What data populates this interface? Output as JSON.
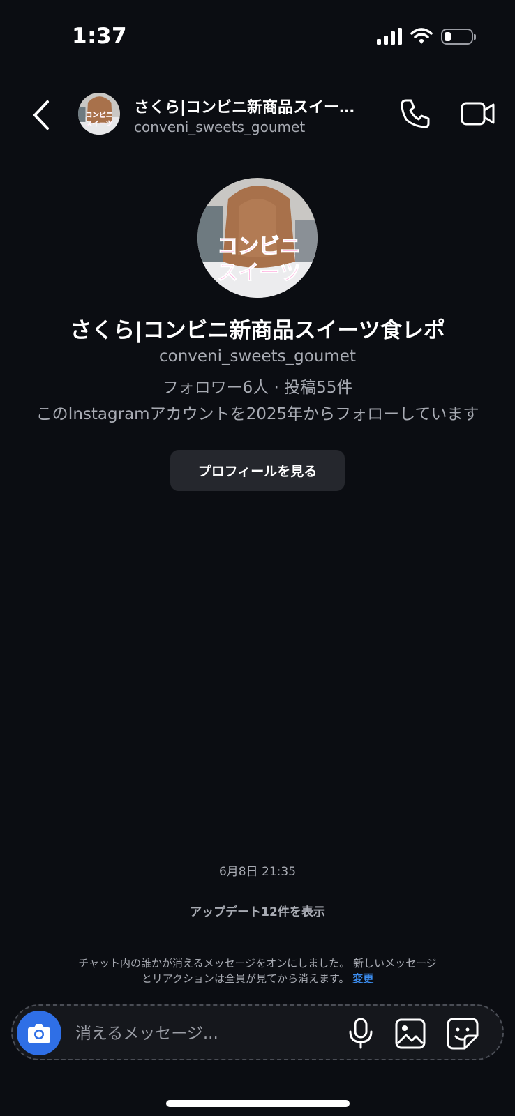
{
  "status_bar": {
    "time": "1:37",
    "battery_level": 0.25
  },
  "header": {
    "title": "さくら|コンビニ新商品スイー…",
    "subtitle": "conveni_sweets_goumet"
  },
  "avatar": {
    "overlay_line1": "コンビニ",
    "overlay_line2": "スイーツ"
  },
  "profile": {
    "name": "さくら|コンビニ新商品スイーツ食レポ",
    "handle": "conveni_sweets_goumet",
    "stats": "フォロワー6人 · 投稿55件",
    "follow_info": "このInstagramアカウントを2025年からフォローしています",
    "view_button": "プロフィールを見る"
  },
  "chat": {
    "timestamp": "6月8日 21:35",
    "updates": "アップデート12件を表示",
    "notice_line1": "チャット内の誰かが消えるメッセージをオンにしました。 新しいメッセージ",
    "notice_line2": "とリアクションは全員が見てから消えます。",
    "notice_link": "変更"
  },
  "composer": {
    "placeholder": "消えるメッセージ..."
  },
  "icons": {
    "back": "chevron-left-icon",
    "call": "phone-icon",
    "video": "video-camera-icon",
    "camera": "camera-icon",
    "mic": "microphone-icon",
    "gallery": "image-icon",
    "sticker": "sticker-icon"
  },
  "colors": {
    "background": "#0b0d12",
    "accent_blue": "#2f6fe6",
    "link_blue": "#3b8df0",
    "pink_text": "#ff4fb8"
  }
}
